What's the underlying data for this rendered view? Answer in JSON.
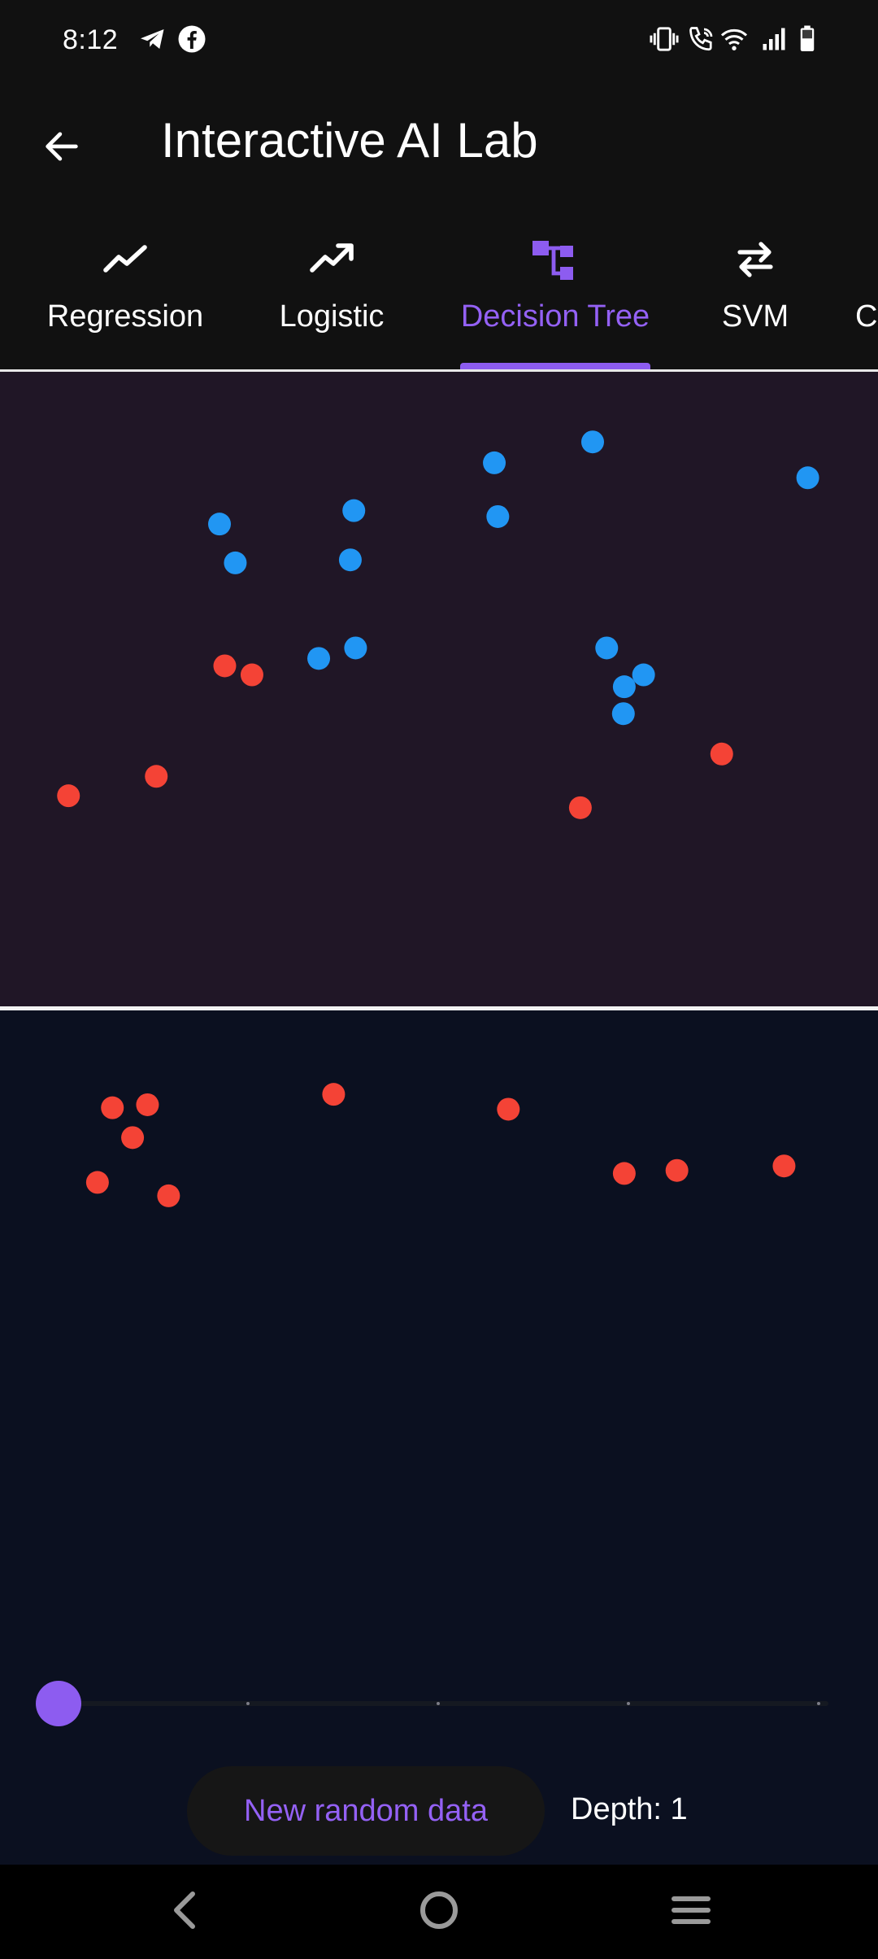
{
  "status_bar": {
    "time": "8:12",
    "left_icons": [
      "telegram-icon",
      "facebook-icon"
    ],
    "right_icons": [
      "vibrate-icon",
      "wifi-calling-icon",
      "wifi-icon",
      "cellular-signal-icon",
      "battery-icon"
    ]
  },
  "app_bar": {
    "title": "Interactive AI Lab",
    "back_icon": "arrow-left-icon"
  },
  "tabs": [
    {
      "label": "Regression",
      "icon": "trending-line-icon",
      "active": false
    },
    {
      "label": "Logistic",
      "icon": "trending-up-icon",
      "active": false
    },
    {
      "label": "Decision Tree",
      "icon": "account-tree-icon",
      "active": true
    },
    {
      "label": "SVM",
      "icon": "swap-arrows-icon",
      "active": false
    },
    {
      "label": "C",
      "icon": "",
      "active": false
    }
  ],
  "colors": {
    "accent": "#8d5cf0",
    "class_blue": "#2196f3",
    "class_red": "#f44336",
    "region_top": "#201626",
    "region_bottom": "#0b1020"
  },
  "chart_data": {
    "type": "scatter",
    "title": "",
    "xlim": [
      0,
      1
    ],
    "ylim": [
      0,
      1
    ],
    "split": {
      "axis": "y",
      "value": 0.575
    },
    "series": [
      {
        "color": "#2196f3",
        "points": [
          [
            0.675,
            0.953
          ],
          [
            0.563,
            0.939
          ],
          [
            0.92,
            0.929
          ],
          [
            0.403,
            0.907
          ],
          [
            0.567,
            0.903
          ],
          [
            0.25,
            0.898
          ],
          [
            0.268,
            0.872
          ],
          [
            0.399,
            0.874
          ],
          [
            0.691,
            0.815
          ],
          [
            0.405,
            0.815
          ],
          [
            0.363,
            0.808
          ],
          [
            0.733,
            0.797
          ],
          [
            0.711,
            0.789
          ],
          [
            0.71,
            0.771
          ]
        ]
      },
      {
        "color": "#f44336",
        "points": [
          [
            0.256,
            0.803
          ],
          [
            0.287,
            0.797
          ],
          [
            0.822,
            0.744
          ],
          [
            0.178,
            0.729
          ],
          [
            0.078,
            0.716
          ],
          [
            0.661,
            0.708
          ],
          [
            0.38,
            0.516
          ],
          [
            0.168,
            0.509
          ],
          [
            0.128,
            0.507
          ],
          [
            0.579,
            0.506
          ],
          [
            0.151,
            0.487
          ],
          [
            0.711,
            0.463
          ],
          [
            0.771,
            0.465
          ],
          [
            0.893,
            0.468
          ],
          [
            0.111,
            0.457
          ],
          [
            0.192,
            0.448
          ]
        ]
      }
    ]
  },
  "slider": {
    "value": 1,
    "min": 1,
    "max": 5
  },
  "buttons": {
    "new_data": "New random data"
  },
  "depth_label": "Depth: 1",
  "nav": {
    "back_icon": "nav-back-icon",
    "home_icon": "nav-home-icon",
    "recents_icon": "nav-recents-icon"
  }
}
